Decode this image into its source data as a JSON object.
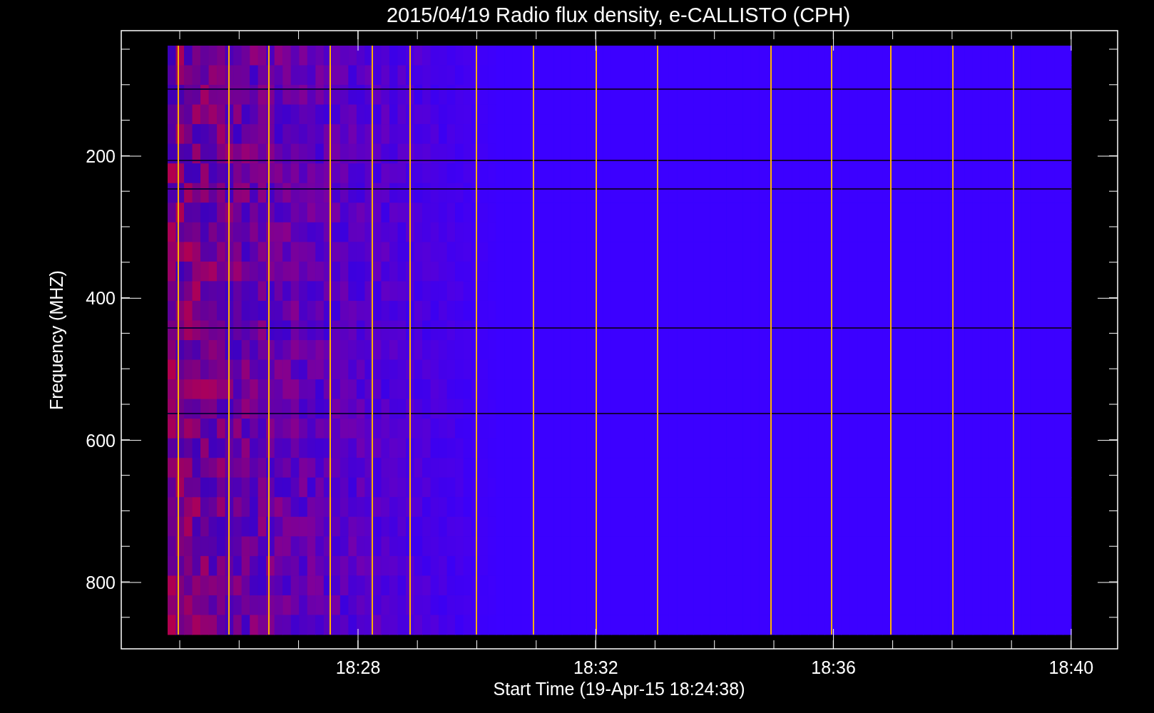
{
  "title": "2015/04/19  Radio flux density, e-CALLISTO (CPH)",
  "y_axis": {
    "label": "Frequency (MHZ)",
    "ticks": [
      "200",
      "400",
      "600",
      "800"
    ]
  },
  "x_axis": {
    "label": "Start Time (19-Apr-15 18:24:38)",
    "ticks": [
      "18:28",
      "18:32",
      "18:36",
      "18:40"
    ]
  }
}
